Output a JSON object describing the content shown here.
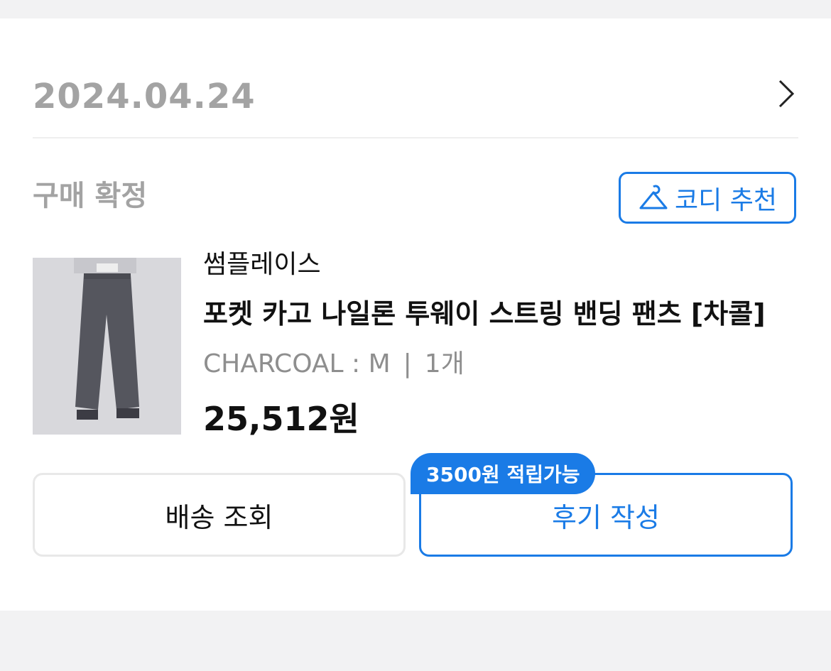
{
  "order": {
    "date": "2024.04.24",
    "status": "구매 확정"
  },
  "codi_button": {
    "label": "코디 추천",
    "icon": "hanger-icon"
  },
  "product": {
    "brand": "썸플레이스",
    "name": "포켓 카고 나일론 투웨이 스트링 밴딩 팬츠 [차콜]",
    "option": "CHARCOAL : M",
    "separator": "|",
    "quantity": "1개",
    "price": "25,512원"
  },
  "actions": {
    "delivery_label": "배송 조회",
    "review_label": "후기 작성",
    "points_badge": "3500원 적립가능"
  },
  "colors": {
    "accent": "#1a7be6",
    "muted": "#a3a3a3"
  }
}
